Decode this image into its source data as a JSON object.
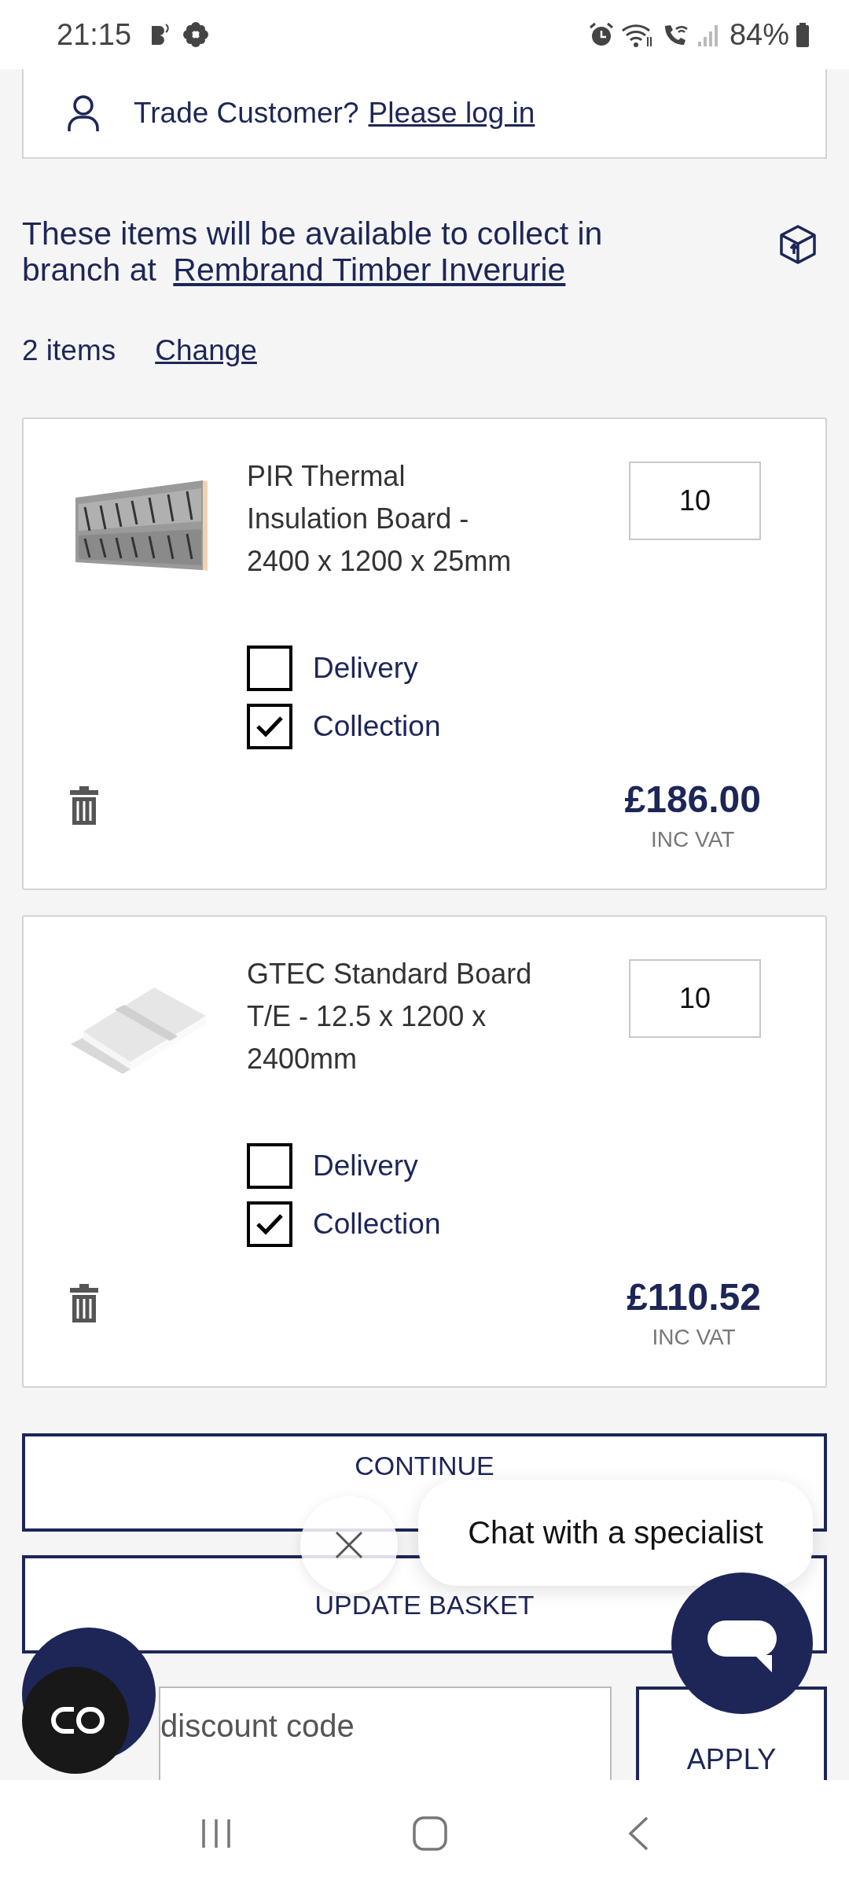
{
  "status_bar": {
    "time": "21:15",
    "battery": "84%"
  },
  "account": {
    "prompt": "Trade Customer?",
    "link": "Please log in"
  },
  "collection_notice": {
    "text": "These items will be available to collect in branch at",
    "branch": "Rembrand Timber Inverurie"
  },
  "basket_summary": {
    "count": "2 items",
    "change": "Change"
  },
  "items": [
    {
      "title": "PIR Thermal Insulation Board - 2400 x 1200 x 25mm",
      "quantity": "10",
      "options": [
        {
          "label": "Delivery",
          "checked": false
        },
        {
          "label": "Collection",
          "checked": true
        }
      ],
      "price": "£186.00",
      "price_note": "INC VAT"
    },
    {
      "title": "GTEC Standard Board T/E - 12.5 x 1200 x 2400mm",
      "quantity": "10",
      "options": [
        {
          "label": "Delivery",
          "checked": false
        },
        {
          "label": "Collection",
          "checked": true
        }
      ],
      "price": "£110.52",
      "price_note": "INC VAT"
    }
  ],
  "buttons": [
    "CONTINUE",
    "UPDATE BASKET"
  ],
  "discount": {
    "placeholder": "discount code",
    "apply": "APPLY"
  },
  "chat": {
    "prompt": "Chat with a specialist"
  }
}
